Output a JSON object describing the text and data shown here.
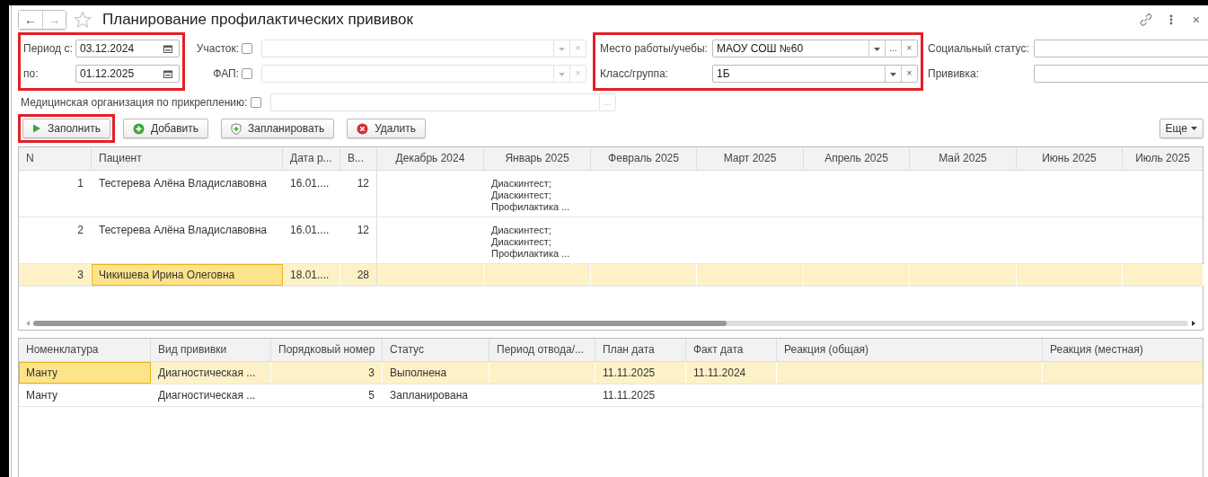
{
  "window": {
    "title": "Планирование профилактических прививок",
    "back": "←",
    "forward": "→",
    "close": "×"
  },
  "period": {
    "highlighted": true,
    "from_label": "Период с:",
    "from": "03.12.2024",
    "to_label": "по:",
    "to": "01.12.2025"
  },
  "uchastok": {
    "label": "Участок:",
    "checked": false,
    "clear": "×"
  },
  "fap": {
    "label": "ФАП:",
    "checked": false,
    "clear": "×"
  },
  "workplace": {
    "highlighted": true,
    "place_label": "Место работы/учебы:",
    "place": "МАОУ СОШ №60",
    "place_more": "...",
    "place_clear": "×",
    "class_label": "Класс/группа:",
    "class": "1Б",
    "class_clear": "×"
  },
  "social_status": {
    "label": "Социальный статус:"
  },
  "vaccine": {
    "label": "Прививка:"
  },
  "med_org": {
    "label": "Медицинская организация по прикреплению:",
    "checked": false,
    "more": "..."
  },
  "toolbar": {
    "buttons": [
      {
        "label": "Заполнить",
        "kind": "fill",
        "highlighted": true
      },
      {
        "label": "Добавить",
        "kind": "add",
        "highlighted": false
      },
      {
        "label": "Запланировать",
        "kind": "plan",
        "highlighted": false
      },
      {
        "label": "Удалить",
        "kind": "delete",
        "highlighted": false
      }
    ],
    "more": "Еще"
  },
  "patients": {
    "columns": [
      "N",
      "Пациент",
      "Дата р...",
      "В...",
      "Декабрь 2024",
      "Январь 2025",
      "Февраль 2025",
      "Март 2025",
      "Апрель 2025",
      "Май 2025",
      "Июнь 2025",
      "Июль 2025"
    ],
    "rows": [
      {
        "n": "1",
        "patient": "Тестерева Алёна Владиславовна",
        "birth": "16.01....",
        "age": "12",
        "selected": false,
        "months": [
          {
            "kind": "empty"
          },
          {
            "kind": "planned",
            "lines": [
              "Диаскинтест;",
              "Диаскинтест;",
              "Профилактика ..."
            ]
          },
          {
            "kind": "empty"
          },
          {
            "kind": "empty"
          },
          {
            "kind": "empty"
          },
          {
            "kind": "empty"
          },
          {
            "kind": "empty"
          },
          {
            "kind": "empty"
          }
        ]
      },
      {
        "n": "2",
        "patient": "Тестерева Алёна Владиславовна",
        "birth": "16.01....",
        "age": "12",
        "selected": false,
        "months": [
          {
            "kind": "empty"
          },
          {
            "kind": "planned",
            "lines": [
              "Диаскинтест;",
              "Диаскинтест;",
              "Профилактика ..."
            ]
          },
          {
            "kind": "empty"
          },
          {
            "kind": "empty"
          },
          {
            "kind": "empty"
          },
          {
            "kind": "empty"
          },
          {
            "kind": "empty"
          },
          {
            "kind": "empty"
          }
        ]
      },
      {
        "n": "3",
        "patient": "Чикишева Ирина Олеговна",
        "birth": "18.01....",
        "age": "28",
        "selected": true,
        "months": [
          {
            "kind": "empty"
          },
          {
            "kind": "empty"
          },
          {
            "kind": "empty"
          },
          {
            "kind": "empty"
          },
          {
            "kind": "empty"
          },
          {
            "kind": "empty"
          },
          {
            "kind": "empty"
          },
          {
            "kind": "empty"
          }
        ]
      }
    ]
  },
  "vaccinations": {
    "columns": [
      "Номенклатура",
      "Вид прививки",
      "Порядковый номер",
      "Статус",
      "Период отвода/...",
      "План дата",
      "Факт дата",
      "Реакция (общая)",
      "Реакция (местная)"
    ],
    "rows": [
      {
        "nomenclature": "Манту",
        "type": "Диагностическая ...",
        "number": "3",
        "status": "Выполнена",
        "plan_date": "11.11.2025",
        "fact_date": "11.11.2024",
        "selected": true
      },
      {
        "nomenclature": "Манту",
        "type": "Диагностическая ...",
        "number": "5",
        "status": "Запланирована",
        "plan_date": "11.11.2025",
        "selected": false
      }
    ]
  }
}
